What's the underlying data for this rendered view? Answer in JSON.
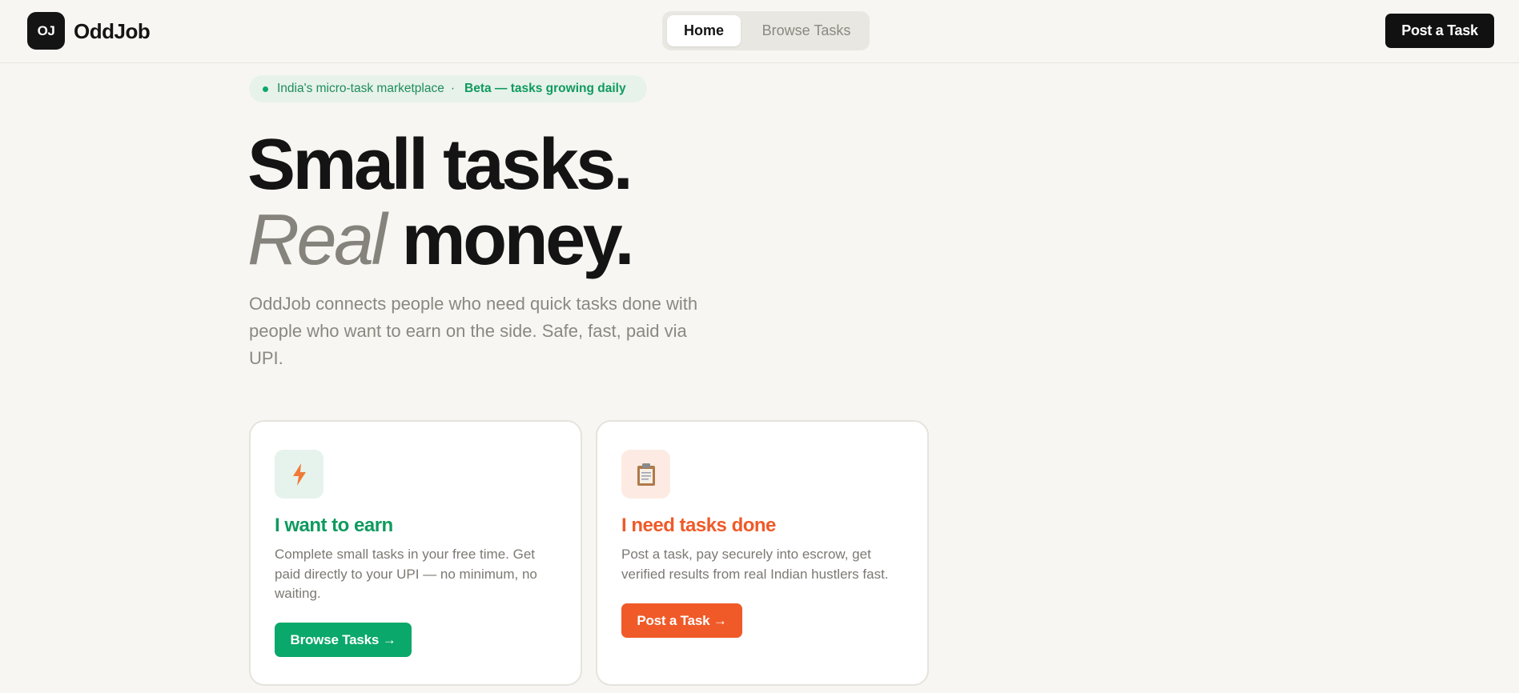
{
  "header": {
    "logo_mark": "OJ",
    "brand": "OddJob",
    "tabs": [
      {
        "label": "Home",
        "active": true
      },
      {
        "label": "Browse Tasks",
        "active": false
      }
    ],
    "post_label": "Post a Task"
  },
  "hero": {
    "badge_text": "India's micro-task marketplace",
    "badge_sep": "·",
    "badge_highlight": "Beta — tasks growing daily",
    "line1": "Small tasks.",
    "line2_italic": "Real",
    "line2_bold": "money.",
    "description": "OddJob connects people who need quick tasks done with people who want to earn on the side. Safe, fast, paid via UPI."
  },
  "cards": [
    {
      "icon": "lightning-icon",
      "title": "I want to earn",
      "description": "Complete small tasks in your free time. Get paid directly to your UPI — no minimum, no waiting.",
      "button": "Browse Tasks →"
    },
    {
      "icon": "clipboard-icon",
      "title": "I need tasks done",
      "description": "Post a task, pay securely into escrow, get verified results from real Indian hustlers fast.",
      "button": "Post a Task →"
    }
  ],
  "colors": {
    "background": "#f7f6f2",
    "dark": "#111111",
    "green": "#0aa86a",
    "orange": "#f05a28",
    "muted": "#8a8880"
  }
}
